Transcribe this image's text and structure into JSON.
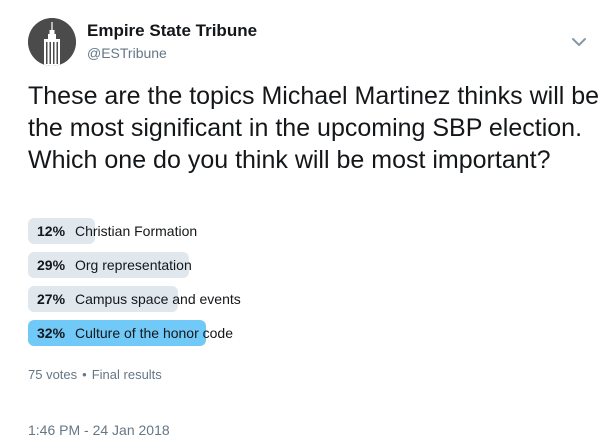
{
  "author": {
    "name": "Empire State Tribune",
    "handle": "@ESTribune",
    "avatar_icon": "building-tower-icon"
  },
  "tweet": {
    "text": "These are the topics Michael Martinez thinks will be the most significant in the upcoming SBP election. Which one do you think will be most important?"
  },
  "poll": {
    "options": [
      {
        "percent_label": "12%",
        "label": "Christian Formation",
        "percent": 12,
        "winner": false
      },
      {
        "percent_label": "29%",
        "label": "Org representation",
        "percent": 29,
        "winner": false
      },
      {
        "percent_label": "27%",
        "label": "Campus space and events",
        "percent": 27,
        "winner": false
      },
      {
        "percent_label": "32%",
        "label": "Culture of the honor code",
        "percent": 32,
        "winner": true
      }
    ],
    "votes": "75 votes",
    "separator": "•",
    "status": "Final results"
  },
  "timestamp": "1:46 PM - 24 Jan 2018",
  "colors": {
    "bar": "#e1e8ed",
    "winner_bar": "#71c9f8",
    "secondary_text": "#657786"
  }
}
